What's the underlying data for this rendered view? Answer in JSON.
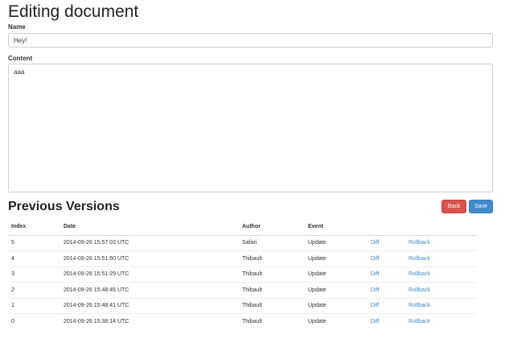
{
  "page": {
    "title": "Editing document"
  },
  "form": {
    "name_label": "Name",
    "name_value": "Hey!",
    "content_label": "Content",
    "content_value": "aaa"
  },
  "versions": {
    "title": "Previous Versions",
    "back_label": "Back",
    "save_label": "Save",
    "columns": [
      "Index",
      "Date",
      "Author",
      "Event",
      "",
      ""
    ],
    "rows": [
      {
        "index": "5",
        "date": "2014-09-26 15:57:03 UTC",
        "author": "Safari",
        "event": "Update",
        "diff": "Diff",
        "rollback": "Rollback"
      },
      {
        "index": "4",
        "date": "2014-09-26 15:51:50 UTC",
        "author": "Thibault",
        "event": "Update",
        "diff": "Diff",
        "rollback": "Rollback"
      },
      {
        "index": "3",
        "date": "2014-09-26 15:51:29 UTC",
        "author": "Thibault",
        "event": "Update",
        "diff": "Diff",
        "rollback": "Rollback"
      },
      {
        "index": "2",
        "date": "2014-09-26 15:48:45 UTC",
        "author": "Thibault",
        "event": "Update",
        "diff": "Diff",
        "rollback": "Rollback"
      },
      {
        "index": "1",
        "date": "2014-09-26 15:48:41 UTC",
        "author": "Thibault",
        "event": "Update",
        "diff": "Diff",
        "rollback": "Rollback"
      },
      {
        "index": "0",
        "date": "2014-09-26 15:38:14 UTC",
        "author": "Thibault",
        "event": "Update",
        "diff": "Diff",
        "rollback": "Rollback"
      }
    ]
  },
  "colors": {
    "back_button": "#d9534f",
    "save_button": "#428bca",
    "link": "#428bca"
  }
}
